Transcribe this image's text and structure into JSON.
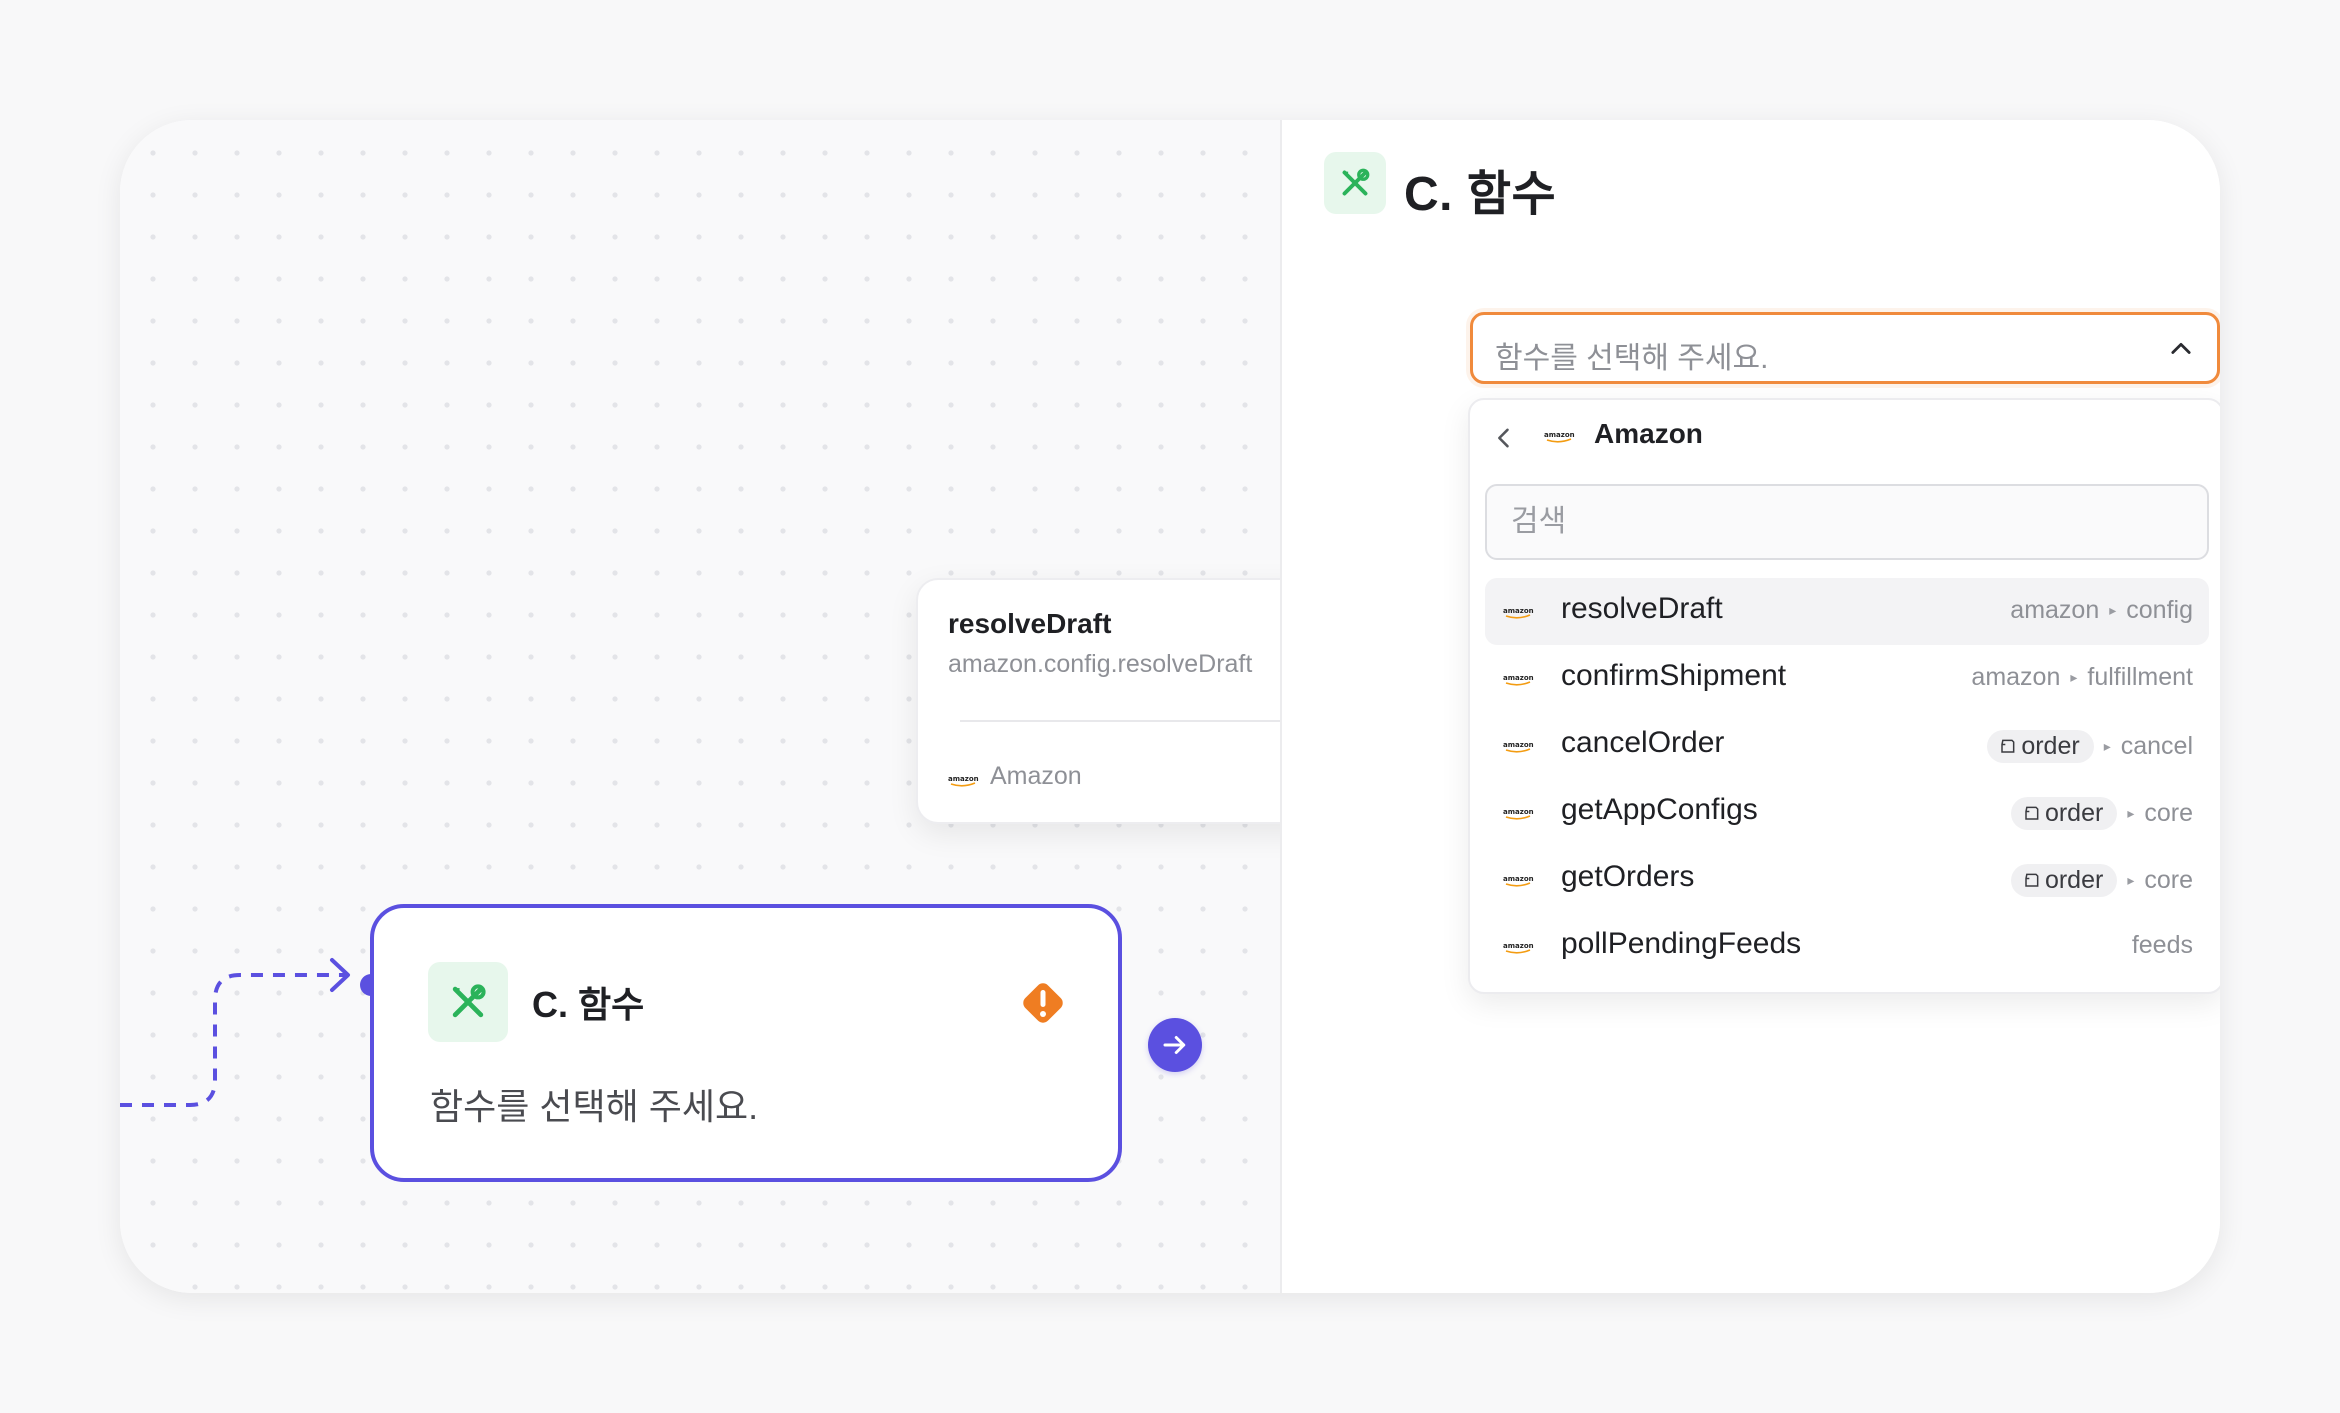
{
  "header": {
    "title": "C. 함수"
  },
  "select": {
    "placeholder": "함수를 선택해 주세요."
  },
  "dropdown": {
    "brand": "Amazon",
    "search_placeholder": "검색",
    "items": [
      {
        "name": "resolveDraft",
        "path": [
          "amazon",
          "config"
        ],
        "chip": null,
        "logo": "amazon"
      },
      {
        "name": "confirmShipment",
        "path": [
          "amazon",
          "fulfillment"
        ],
        "chip": null,
        "logo": "amazon"
      },
      {
        "name": "cancelOrder",
        "path": [
          "order",
          "cancel"
        ],
        "chip": "order",
        "logo": "amazon"
      },
      {
        "name": "getAppConfigs",
        "path": [
          "order",
          "core"
        ],
        "chip": "order",
        "logo": "amazon"
      },
      {
        "name": "getOrders",
        "path": [
          "order",
          "core"
        ],
        "chip": "order",
        "logo": "amazon"
      },
      {
        "name": "pollPendingFeeds",
        "path": [
          "feeds"
        ],
        "chip": null,
        "logo": "amazon"
      }
    ]
  },
  "tooltip": {
    "title": "resolveDraft",
    "subtitle": "amazon.config.resolveDraft",
    "brand": "Amazon"
  },
  "node": {
    "title": "C. 함수",
    "description": "함수를 선택해 주세요.",
    "status_icon": "warning-icon"
  },
  "colors": {
    "accent": "#5b50e0",
    "focus_border": "#f08a3c",
    "tool_icon": "#2bb35a",
    "warning": "#ef7d22"
  }
}
